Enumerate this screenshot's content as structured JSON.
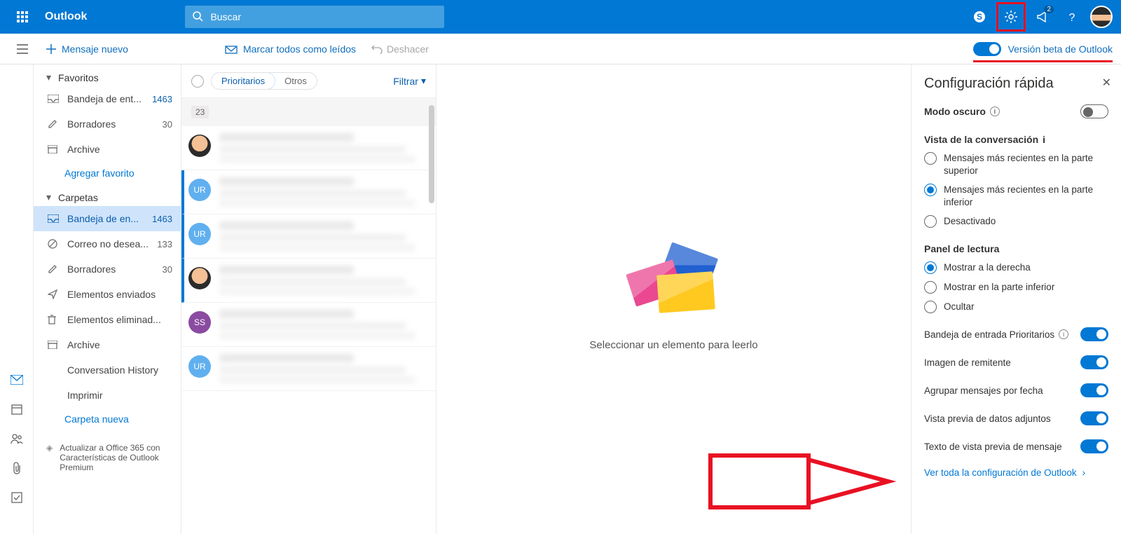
{
  "header": {
    "brand": "Outlook",
    "search_placeholder": "Buscar",
    "notif_badge": "2"
  },
  "cmd": {
    "new_message": "Mensaje nuevo",
    "mark_all": "Marcar todos como leídos",
    "undo": "Deshacer",
    "beta_label": "Versión beta de Outlook"
  },
  "sidebar": {
    "favorites_title": "Favoritos",
    "fav": [
      {
        "label": "Bandeja de ent...",
        "count": "1463"
      },
      {
        "label": "Borradores",
        "count": "30"
      },
      {
        "label": "Archive",
        "count": ""
      }
    ],
    "add_fav": "Agregar favorito",
    "folders_title": "Carpetas",
    "folders": [
      {
        "label": "Bandeja de en...",
        "count": "1463"
      },
      {
        "label": "Correo no desea...",
        "count": "133"
      },
      {
        "label": "Borradores",
        "count": "30"
      },
      {
        "label": "Elementos enviados",
        "count": ""
      },
      {
        "label": "Elementos eliminad...",
        "count": ""
      },
      {
        "label": "Archive",
        "count": ""
      },
      {
        "label": "Conversation History",
        "count": ""
      },
      {
        "label": "Imprimir",
        "count": ""
      }
    ],
    "new_folder": "Carpeta nueva",
    "upgrade": "Actualizar a Office 365 con Características de Outlook Premium"
  },
  "msgcol": {
    "tab_focused": "Prioritarios",
    "tab_other": "Otros",
    "filter": "Filtrar",
    "day_badge": "23",
    "avatars": [
      "face",
      "ur",
      "ur",
      "face",
      "ss",
      "ur"
    ],
    "avatar_initials": {
      "ur": "UR",
      "ss": "SS",
      "face": ""
    }
  },
  "reading": {
    "empty_text": "Seleccionar un elemento para leerlo"
  },
  "settings": {
    "title": "Configuración rápida",
    "dark_mode": "Modo oscuro",
    "conv_view_title": "Vista de la conversación",
    "conv_opts": [
      "Mensajes más recientes en la parte superior",
      "Mensajes más recientes en la parte inferior",
      "Desactivado"
    ],
    "reading_pane_title": "Panel de lectura",
    "pane_opts": [
      "Mostrar a la derecha",
      "Mostrar en la parte inferior",
      "Ocultar"
    ],
    "focused_inbox": "Bandeja de entrada Prioritarios",
    "sender_image": "Imagen de remitente",
    "group_by_date": "Agrupar mensajes por fecha",
    "attach_preview": "Vista previa de datos adjuntos",
    "preview_text": "Texto de vista previa de mensaje",
    "all_settings": "Ver toda la configuración de Outlook"
  }
}
